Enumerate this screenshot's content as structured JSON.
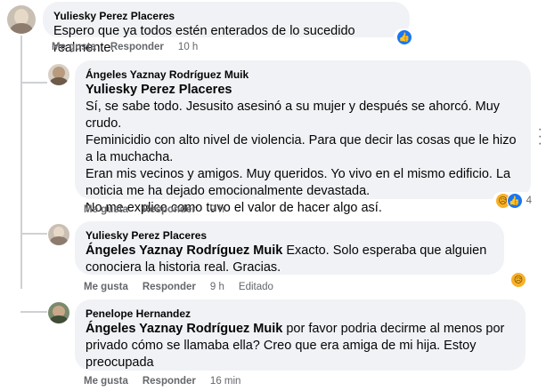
{
  "comments": [
    {
      "author": "Yuliesky Perez Placeres",
      "text": "Espero que ya todos estén enterados de lo sucedido realmente.",
      "like_label": "Me gusta",
      "reply_label": "Responder",
      "time": "10 h",
      "reaction_icon": "like-icon"
    },
    {
      "author": "Ángeles Yaznay Rodríguez Muik",
      "mention": "Yuliesky Perez Placeres",
      "lines": [
        "Sí, se sabe todo. Jesusito asesinó a su mujer y después se ahorcó. Muy crudo.",
        "Feminicidio con alto nivel de violencia. Para que decir las cosas que le hizo a la muchacha.",
        "Eran mis vecinos y amigos. Muy queridos. Yo vivo en el mismo edificio. La noticia me ha dejado emocionalmente devastada.",
        "No me explico como tuvo el valor de hacer algo así."
      ],
      "like_label": "Me gusta",
      "reply_label": "Responder",
      "time": "9 h",
      "reactions": [
        "sad-icon",
        "like-icon"
      ],
      "reaction_count": "4"
    },
    {
      "author": "Yuliesky Perez Placeres",
      "mention": "Ángeles Yaznay Rodríguez Muik",
      "text": " Exacto. Solo esperaba que alguien conociera la historia real. Gracias.",
      "like_label": "Me gusta",
      "reply_label": "Responder",
      "time": "9 h",
      "edited": "Editado",
      "reaction_icon": "sad-icon"
    },
    {
      "author": "Penelope Hernandez",
      "mention": "Ángeles Yaznay Rodríguez Muik",
      "text": " por favor podria decirme al menos por privado cómo se llamaba ella? Creo que era amiga de mi hija. Estoy preocupada",
      "like_label": "Me gusta",
      "reply_label": "Responder",
      "time": "16 min"
    }
  ],
  "colors": {
    "bubble": "#f0f2f5",
    "meta": "#65676b",
    "like": "#1877f2",
    "sad": "#f7b125"
  }
}
